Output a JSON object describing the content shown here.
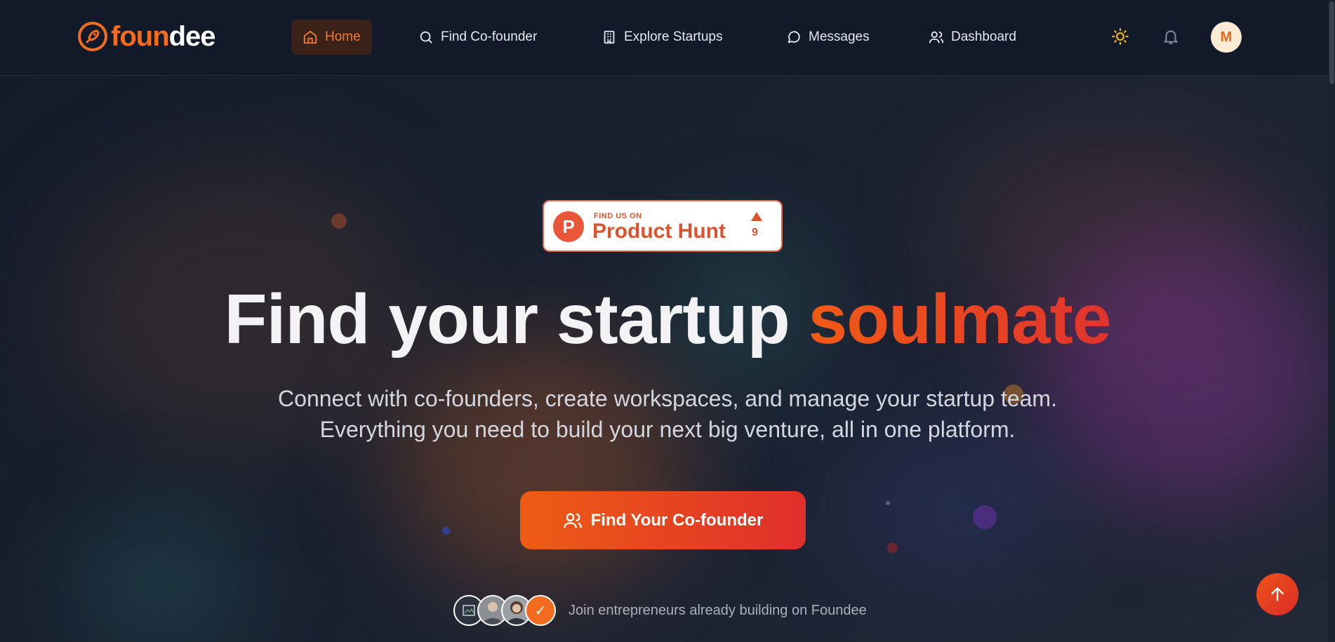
{
  "brand": {
    "name_part1": "foun",
    "name_part2": "dee",
    "accent": "#f26b1f"
  },
  "nav": {
    "items": [
      {
        "label": "Home",
        "icon": "home-icon",
        "active": true
      },
      {
        "label": "Find Co-founder",
        "icon": "search-icon"
      },
      {
        "label": "Explore Startups",
        "icon": "building-icon"
      },
      {
        "label": "Messages",
        "icon": "message-icon"
      },
      {
        "label": "Dashboard",
        "icon": "users-icon"
      }
    ],
    "theme_icon": "sun-icon",
    "notifications_icon": "bell-icon",
    "avatar_initial": "M"
  },
  "product_hunt": {
    "small_text": "FIND US ON",
    "big_text": "Product Hunt",
    "logo_letter": "P",
    "upvotes": "9"
  },
  "hero": {
    "headline_plain": "Find your startup ",
    "headline_highlight": "soulmate",
    "subtitle_line1": "Connect with co-founders, create workspaces, and manage your startup team.",
    "subtitle_line2": "Everything you need to build your next big venture, all in one platform.",
    "cta_label": "Find Your Co-founder",
    "joined_badge": "✓",
    "social_proof": "Join entrepreneurs already building on Foundee"
  },
  "colors": {
    "background": "#161d2b",
    "nav_bg": "#121a2a",
    "cta_start": "#ee5c14",
    "cta_end": "#df2f2c"
  }
}
